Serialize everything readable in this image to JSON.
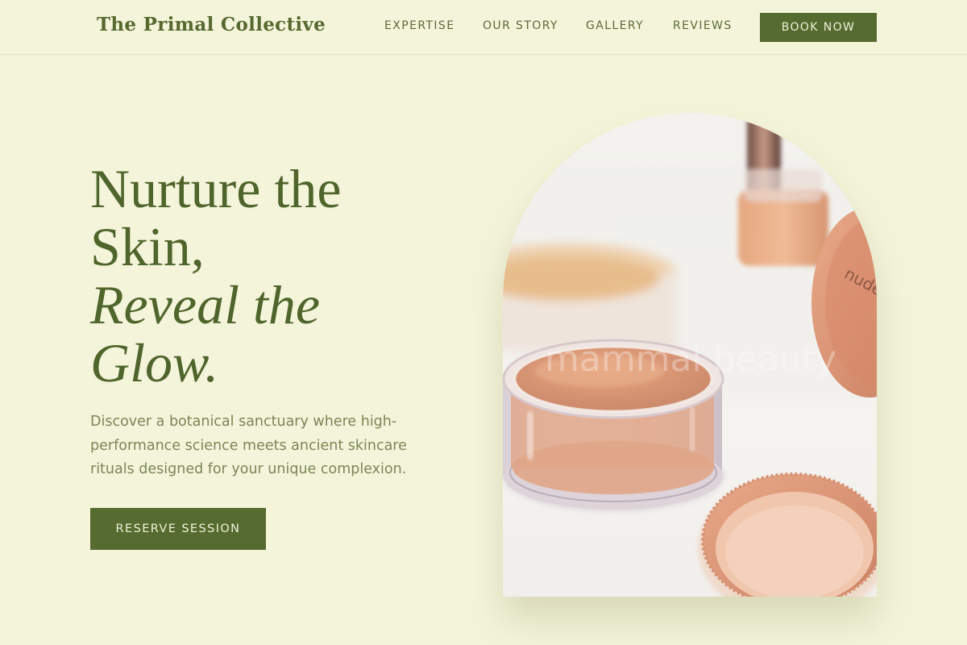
{
  "brand": {
    "name": "The Primal Collective"
  },
  "nav": {
    "links": [
      "EXPERTISE",
      "OUR STORY",
      "GALLERY",
      "REVIEWS"
    ],
    "cta_label": "BOOK NOW"
  },
  "hero": {
    "title_line1": "Nurture the",
    "title_line2": "Skin,",
    "title_line3": "Reveal the",
    "title_line4": "Glow.",
    "description": "Discover a botanical sanctuary where high-performance science meets ancient skincare rituals designed for your unique complexion.",
    "cta_label": "RESERVE SESSION"
  },
  "image": {
    "watermark_text": "mammal beauty",
    "jar_label_text": "nude"
  },
  "colors": {
    "background": "#f4f4da",
    "accent": "#566b30",
    "heading": "#4f652b",
    "body_text": "#7b8656",
    "button_text": "#eef0d8"
  }
}
